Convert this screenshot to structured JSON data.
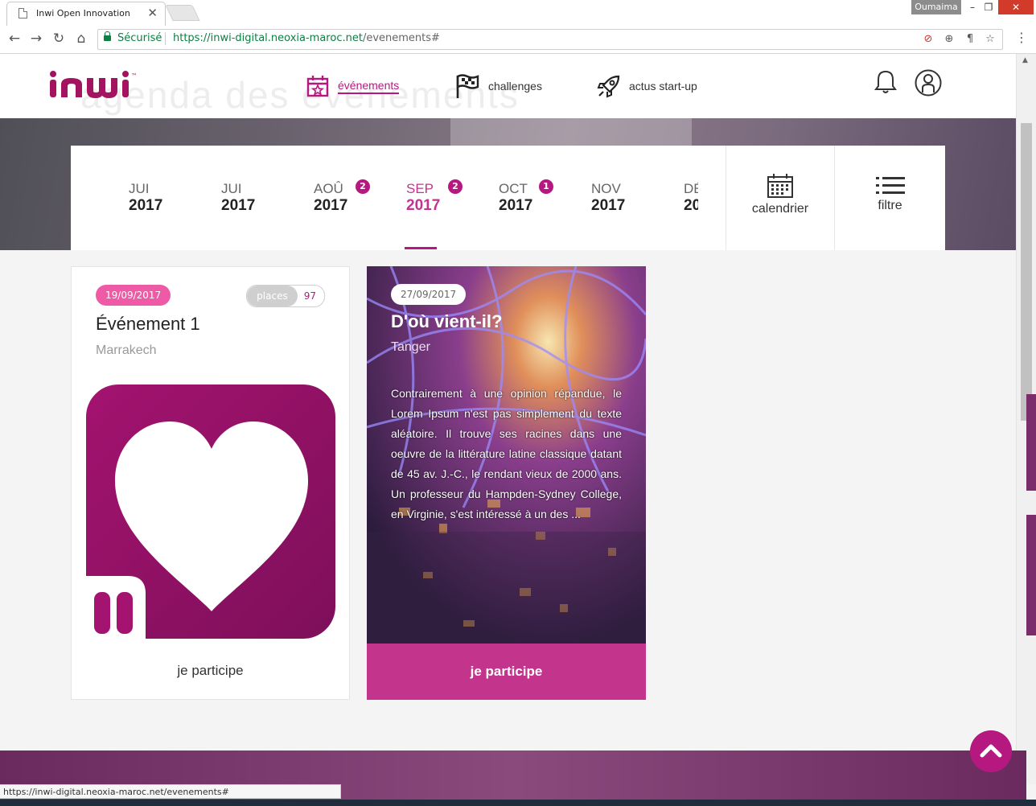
{
  "browser": {
    "tab_title": "Inwi Open Innovation",
    "tab_close": "✕",
    "profile_name": "Oumaima",
    "secure_label": "Sécurisé",
    "url_host": "https://inwi-digital.neoxia-maroc.net",
    "url_path": "/evenements#",
    "status_url": "https://inwi-digital.neoxia-maroc.net/evenements#"
  },
  "header": {
    "logo_text": "inwi",
    "logo_tm": "™",
    "background_word": "agenda des évènements",
    "nav": [
      {
        "label": "événements",
        "icon": "calendar-star-icon",
        "active": true
      },
      {
        "label": "challenges",
        "icon": "flag-icon",
        "active": false
      },
      {
        "label": "actus start-up",
        "icon": "rocket-icon",
        "active": false
      }
    ]
  },
  "months": [
    {
      "month": "JUI",
      "year": "2017",
      "badge": null
    },
    {
      "month": "JUI",
      "year": "2017",
      "badge": null
    },
    {
      "month": "AOÛ",
      "year": "2017",
      "badge": "2"
    },
    {
      "month": "SEP",
      "year": "2017",
      "badge": "2",
      "active": true
    },
    {
      "month": "OCT",
      "year": "2017",
      "badge": "1"
    },
    {
      "month": "NOV",
      "year": "2017",
      "badge": null
    },
    {
      "month": "DÉ",
      "year": "20",
      "badge": null
    }
  ],
  "actions": {
    "calendar_label": "calendrier",
    "filter_label": "filtre"
  },
  "events": [
    {
      "date": "19/09/2017",
      "places_label": "places",
      "places_count": "97",
      "title": "Événement 1",
      "city": "Marrakech",
      "cta": "je participe"
    },
    {
      "date": "27/09/2017",
      "title": "D'où vient-il?",
      "city": "Tanger",
      "description": "Contrairement à une opinion répandue, le Lorem Ipsum n'est pas simplement du texte aléatoire. Il trouve ses racines dans une oeuvre de la littérature latine classique datant de 45 av. J.-C., le rendant vieux de 2000 ans. Un professeur du Hampden-Sydney College, en Virginie, s'est intéressé à un des ...",
      "cta": "je participe"
    }
  ],
  "colors": {
    "brand": "#b5197f",
    "brand_light": "#ef5aa6",
    "cta": "#c3358c"
  }
}
